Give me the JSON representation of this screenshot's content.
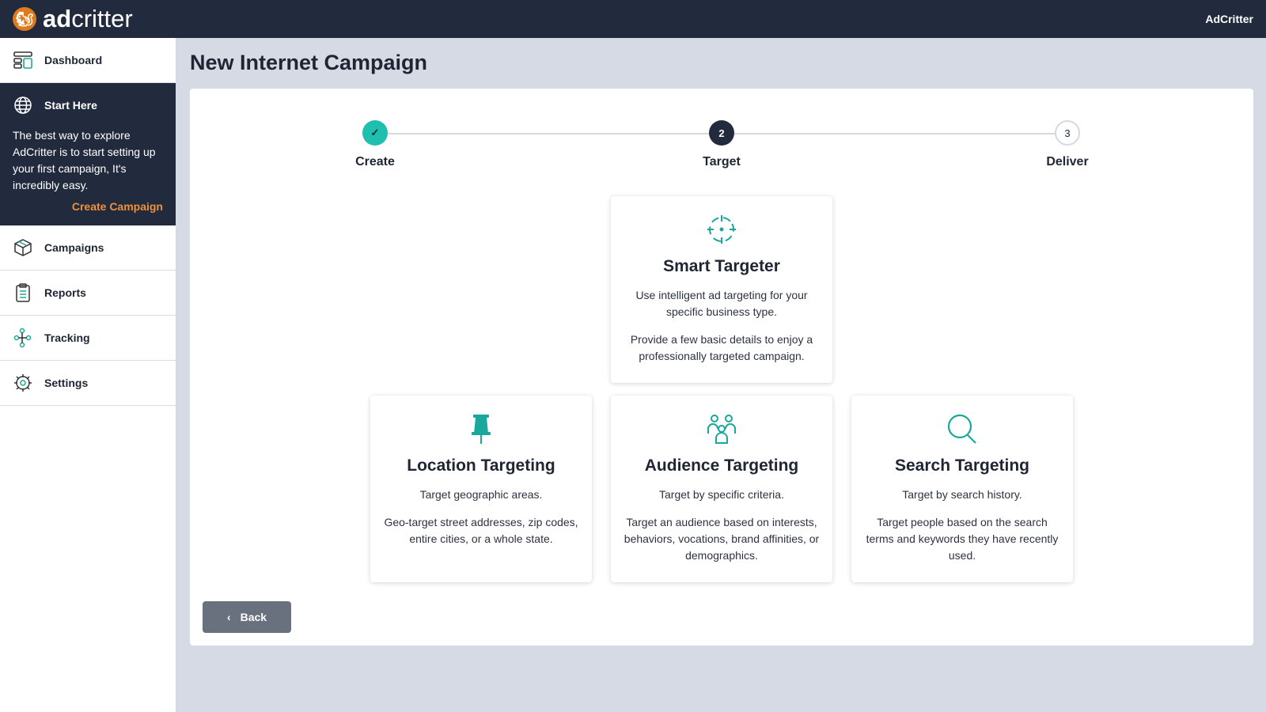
{
  "header": {
    "logo": "adcritter",
    "logo_bold": "ad",
    "logo_light": "critter",
    "user": "AdCritter"
  },
  "sidebar": {
    "dashboard": "Dashboard",
    "start_here": {
      "title": "Start Here",
      "text": "The best way to explore AdCritter is to start setting up your first campaign, It's incredibly easy.",
      "link": "Create Campaign"
    },
    "items": [
      {
        "label": "Campaigns"
      },
      {
        "label": "Reports"
      },
      {
        "label": "Tracking"
      },
      {
        "label": "Settings"
      }
    ]
  },
  "page": {
    "title": "New Internet Campaign"
  },
  "stepper": {
    "steps": [
      {
        "label": "Create",
        "state": "complete"
      },
      {
        "label": "Target",
        "number": "2",
        "state": "current"
      },
      {
        "label": "Deliver",
        "number": "3",
        "state": "upcoming"
      }
    ]
  },
  "cards": [
    {
      "title": "Smart Targeter",
      "icon": "crosshair-icon",
      "line1": "Use intelligent ad targeting for your specific business type.",
      "line2": "Provide a few basic details to enjoy a professionally targeted campaign."
    },
    {
      "title": "Location Targeting",
      "icon": "pushpin-icon",
      "line1": "Target geographic areas.",
      "line2": "Geo-target street addresses, zip codes, entire cities, or a whole state."
    },
    {
      "title": "Audience Targeting",
      "icon": "people-icon",
      "line1": "Target by specific criteria.",
      "line2": "Target an audience based on interests, behaviors, vocations, brand affinities, or demographics."
    },
    {
      "title": "Search Targeting",
      "icon": "search-icon",
      "line1": "Target by search history.",
      "line2": "Target people based on the search terms and keywords they have recently used."
    }
  ],
  "back": "Back",
  "colors": {
    "accent": "#1aa89c",
    "navy": "#222b3e",
    "orange": "#ee8f3a"
  }
}
